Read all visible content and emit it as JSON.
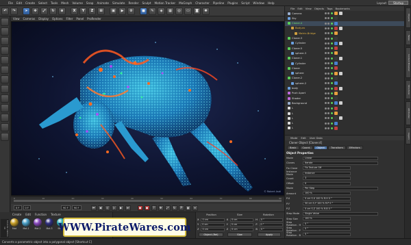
{
  "app": {
    "menu": [
      "File",
      "Edit",
      "Create",
      "Select",
      "Tools",
      "Mesh",
      "Volume",
      "Snap",
      "Animate",
      "Simulate",
      "Render",
      "Sculpt",
      "Motion Tracker",
      "MoGraph",
      "Character",
      "Pipeline",
      "Plugins",
      "Script",
      "Window",
      "Help"
    ],
    "layout_label": "Layout:",
    "layout_value": "Startup"
  },
  "viewport": {
    "menu": [
      "View",
      "Cameras",
      "Display",
      "Options",
      "Filter",
      "Panel",
      "ProRender"
    ],
    "credit": "© Robert Asdi"
  },
  "timeline": {
    "ticks": [
      "0",
      "10",
      "20",
      "30",
      "40",
      "50",
      "60",
      "70",
      "80",
      "90"
    ],
    "frame_start": "0 F",
    "frame_cur": "0 F",
    "frame_end": "90 F",
    "frame_max": "90 F"
  },
  "materials": {
    "menu": [
      "Create",
      "Edit",
      "Function",
      "Texture"
    ],
    "items": [
      {
        "label": "Mat",
        "color": "#c9a028"
      },
      {
        "label": "Mat.1",
        "color": "#4aa0c8"
      },
      {
        "label": "Mat.2",
        "color": "#8a4ac0"
      },
      {
        "label": "Mat.3",
        "color": "#303080"
      },
      {
        "label": "Mat.4",
        "color": "#30b0b8"
      },
      {
        "label": "Mat.5",
        "color": "#d0d0d0"
      }
    ],
    "logo": "MAXON CINEMA 4D"
  },
  "watermark": "WWW.PirateWares.com",
  "coords": {
    "headers": [
      "Position",
      "Size",
      "Rotation"
    ],
    "rows": [
      {
        "a": "X",
        "p": "0 cm",
        "s": "0 cm",
        "r": "H",
        "rv": "0 °"
      },
      {
        "a": "Y",
        "p": "0 cm",
        "s": "0 cm",
        "r": "P",
        "rv": "0 °"
      },
      {
        "a": "Z",
        "p": "0 cm",
        "s": "0 cm",
        "r": "B",
        "rv": "0 °"
      }
    ],
    "object_btn": "Object (Rel)",
    "size_btn": "Size",
    "apply_btn": "Apply"
  },
  "status": "Converts a parametric object into a polygonal object [Shortcut C]",
  "objects": {
    "menu": [
      "File",
      "Edit",
      "View",
      "Objects",
      "Tags",
      "Bookmarks"
    ],
    "rows": [
      {
        "name": "Camera",
        "indent": 0,
        "color": "#9ab0d0"
      },
      {
        "name": "Sky",
        "indent": 0,
        "color": "#6aa0e0"
      },
      {
        "name": "Cloner.4",
        "indent": 0,
        "color": "#5ad05a",
        "name_color": "#6fe06f"
      },
      {
        "name": "Body.ex",
        "indent": 1,
        "color": "#d0a040",
        "name_color": "#e0b040"
      },
      {
        "name": "Matrix.Bridge",
        "indent": 2,
        "color": "#d0a040",
        "name_color": "#e0b040"
      },
      {
        "name": "Cloner.3",
        "indent": 0,
        "color": "#5ad05a"
      },
      {
        "name": "Cylinder",
        "indent": 1,
        "color": "#6aa0e0"
      },
      {
        "name": "Cloner.5",
        "indent": 0,
        "color": "#5ad05a"
      },
      {
        "name": "sphere.3",
        "indent": 1,
        "color": "#6aa0e0"
      },
      {
        "name": "Cloner.1",
        "indent": 0,
        "color": "#5ad05a"
      },
      {
        "name": "Cylinder",
        "indent": 1,
        "color": "#6aa0e0"
      },
      {
        "name": "Cloner",
        "indent": 0,
        "color": "#5ad05a"
      },
      {
        "name": "sphere",
        "indent": 1,
        "color": "#6aa0e0"
      },
      {
        "name": "Cloner.2",
        "indent": 0,
        "color": "#5ad05a"
      },
      {
        "name": "sphere.2",
        "indent": 1,
        "color": "#6aa0e0"
      },
      {
        "name": "body",
        "indent": 0,
        "color": "#6aa0e0"
      },
      {
        "name": "Push Apart",
        "indent": 0,
        "color": "#c06ae0"
      },
      {
        "name": "Shader",
        "indent": 0,
        "color": "#c06ae0"
      },
      {
        "name": "Background",
        "indent": 0,
        "color": "#9ab0d0"
      },
      {
        "name": "L",
        "indent": 0,
        "color": "#e0e0e0"
      },
      {
        "name": "L",
        "indent": 0,
        "color": "#e0e0e0"
      },
      {
        "name": "L",
        "indent": 0,
        "color": "#e0e0e0"
      },
      {
        "name": "L",
        "indent": 0,
        "color": "#e0e0e0"
      },
      {
        "name": "L",
        "indent": 0,
        "color": "#e0e0e0"
      }
    ]
  },
  "attributes": {
    "menu": [
      "Mode",
      "Edit",
      "User Data"
    ],
    "title": "Cloner Object [Cloner.4]",
    "tabs": [
      "Basic",
      "Coord.",
      "Object",
      "Transform",
      "Effectors"
    ],
    "active_tab": 2,
    "section": "Object Properties",
    "props": [
      {
        "label": "Mode",
        "value": "Linear"
      },
      {
        "label": "Clones",
        "value": "Iterate"
      },
      {
        "label": "Fix Clone",
        "value": "Fix Texture  Off"
      },
      {
        "label": "Instance Mode",
        "value": "Instance"
      },
      {
        "label": "Count",
        "value": "3"
      },
      {
        "label": "Offset",
        "value": "0"
      },
      {
        "label": "Mode",
        "value": "Per Step"
      },
      {
        "label": "Amount",
        "value": "100 %"
      },
      {
        "label": "P.X",
        "value": "0 cm   S.X  100 %   R.H  0 °"
      },
      {
        "label": "P.Y",
        "value": "50 cm  S.Y  100 %   R.P  0 °"
      },
      {
        "label": "P.Z",
        "value": "0 cm   S.Z  100 %   R.B  0 °"
      },
      {
        "label": "Step Mode",
        "value": "Single Value"
      },
      {
        "label": "Step Size",
        "value": "100 %"
      },
      {
        "label": "Step Rotation . H",
        "value": "0 °"
      },
      {
        "label": "Step Rotation . P",
        "value": "0 °"
      },
      {
        "label": "Step Rotation . B",
        "value": "0 °"
      }
    ]
  },
  "side_tabs": [
    "Objects",
    "Takes",
    "Content Browser",
    "Structure",
    "Attributes",
    "Layers"
  ]
}
